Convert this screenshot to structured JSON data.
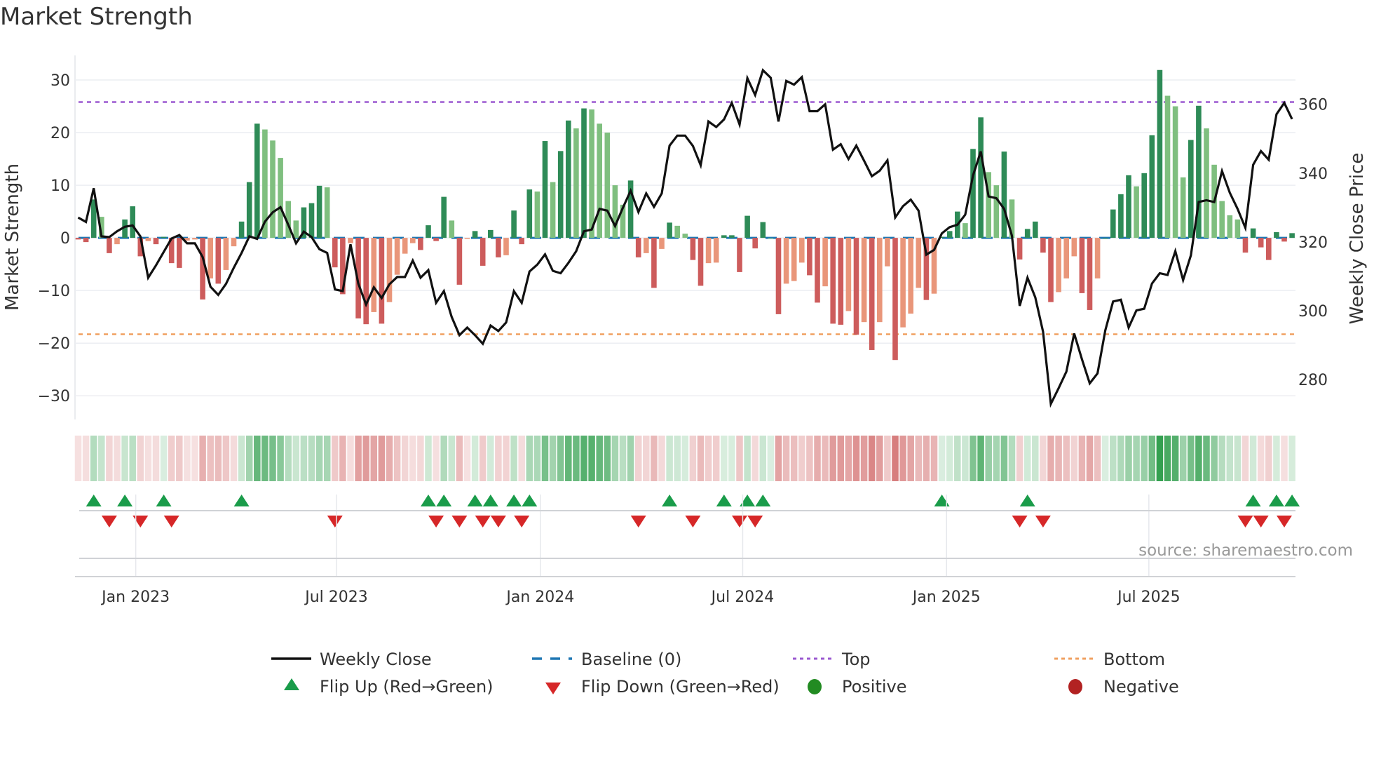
{
  "chart_data": {
    "type": "bar",
    "title": "Market Strength",
    "ylabel": "Market Strength",
    "y2label": "Weekly Close Price",
    "ylim": [
      -34.5,
      34.4
    ],
    "y2lim": [
      268.4,
      373.8
    ],
    "yticks": [
      30,
      20,
      10,
      0,
      -10,
      -20,
      -30
    ],
    "ytick_labels": [
      "30",
      "20",
      "10",
      "0",
      "−10",
      "−20",
      "−30"
    ],
    "y2ticks": [
      280,
      300,
      320,
      340,
      360
    ],
    "y2tick_labels": [
      "280",
      "300",
      "320",
      "340",
      "360"
    ],
    "xtick_labels": [
      "Jan 2023",
      "Jul 2023",
      "Jan 2024",
      "Jul 2024",
      "Jan 2025",
      "Jul 2025"
    ],
    "xtick_weeks": [
      7.4,
      33.2,
      59.4,
      85.4,
      111.6,
      137.6
    ],
    "top_level": 25.8,
    "bottom_level": -18.3,
    "grid": true,
    "legend_position": "bottom",
    "source": "source: sharemaestro.com",
    "strength": [
      -0.3,
      -0.8,
      7.3,
      4,
      -2.9,
      -1.2,
      3.5,
      6,
      -3.5,
      -0.6,
      -1.2,
      0.2,
      -4.8,
      -5.7,
      -0.5,
      -0.3,
      -11.7,
      -7.7,
      -8.7,
      -6.1,
      -1.6,
      3.1,
      10.6,
      21.7,
      20.6,
      18.5,
      15.2,
      7,
      3.3,
      5.8,
      6.6,
      9.9,
      9.6,
      -5.6,
      -10.7,
      -1,
      -15.3,
      -16.4,
      -14.1,
      -16.3,
      -12.2,
      -7,
      -3,
      -1,
      -2.3,
      2.4,
      -0.6,
      7.8,
      3.3,
      -8.9,
      -0.2,
      1.3,
      -5.3,
      1.5,
      -3.7,
      -3.3,
      5.2,
      -1.2,
      9.2,
      8.8,
      18.4,
      10.6,
      16.5,
      22.3,
      20.8,
      24.6,
      24.4,
      21.7,
      20,
      10,
      6.3,
      10.9,
      -3.7,
      -2.9,
      -9.5,
      -2.1,
      2.9,
      2.3,
      0.8,
      -4.2,
      -9.1,
      -4.8,
      -4.7,
      0.5,
      0.5,
      -6.5,
      4.2,
      -2,
      3,
      0,
      -14.5,
      -8.7,
      -8.2,
      -4.7,
      -7.1,
      -12.3,
      -9.2,
      -16.3,
      -16.5,
      -13.9,
      -18.4,
      -16,
      -21.3,
      -16,
      -5.4,
      -23.2,
      -17,
      -14.4,
      -9.5,
      -11.8,
      -10.6,
      0.2,
      1.3,
      5,
      2.8,
      16.9,
      22.9,
      12.5,
      10,
      16.4,
      7.3,
      -4.1,
      1.7,
      3.1,
      -2.8,
      -12.2,
      -10.3,
      -7.7,
      -3.5,
      -10.5,
      -13.7,
      -7.7,
      0,
      5.4,
      8.3,
      11.9,
      9.8,
      12.3,
      19.5,
      31.9,
      27,
      25,
      11.5,
      18.6,
      25.1,
      20.8,
      13.9,
      7,
      4.3,
      3.5,
      -2.8,
      1.8,
      -1.8,
      -4.2,
      1.1,
      -0.7,
      0.9
    ],
    "weekly_close": [
      327.1,
      325.8,
      335.6,
      321.6,
      321.4,
      323.1,
      324.4,
      324.8,
      321.6,
      309.6,
      313.2,
      317.1,
      321,
      322,
      319.6,
      319.6,
      315.6,
      307,
      304.6,
      307.8,
      312.5,
      316.8,
      321.6,
      320.9,
      325.9,
      328.6,
      330.1,
      325,
      319.6,
      323,
      321.4,
      317.9,
      316.8,
      306.2,
      305.7,
      319.3,
      307.9,
      301.8,
      306.8,
      303.7,
      307.7,
      309.8,
      309.8,
      314.6,
      309.6,
      311.8,
      302.3,
      305.7,
      298.2,
      292.9,
      295.1,
      292.9,
      290.4,
      295.7,
      294.1,
      296.6,
      305.7,
      302.3,
      311.4,
      313.4,
      316.4,
      311.6,
      310.9,
      313.9,
      317.3,
      323.1,
      323.6,
      329.6,
      329.1,
      324.6,
      329.9,
      334.9,
      328.7,
      334.1,
      330.2,
      334.1,
      348,
      350.9,
      350.9,
      347.9,
      342.3,
      355,
      353.4,
      355.6,
      360.4,
      354.1,
      367.6,
      362.7,
      369.9,
      367.7,
      355,
      366.8,
      365.7,
      367.9,
      358,
      358,
      360,
      346.8,
      348.4,
      344.1,
      348,
      343.6,
      339.1,
      340.7,
      343.7,
      327.1,
      330.4,
      332.3,
      329.1,
      316.3,
      317.7,
      322.5,
      324.3,
      325,
      327.9,
      339.3,
      346.3,
      333.2,
      332.7,
      329.6,
      321.8,
      301.4,
      309.6,
      303.9,
      293.9,
      272.9,
      277.5,
      282.3,
      293.4,
      285.9,
      278.9,
      281.8,
      294.3,
      302.7,
      303.2,
      295.1,
      300.1,
      300.6,
      307.9,
      310.9,
      310.4,
      317.3,
      308.9,
      316.1,
      331.6,
      332.1,
      331.6,
      340.6,
      334.3,
      329.6,
      324.1,
      342.4,
      346.4,
      343.9,
      357.1,
      360.4,
      355.7
    ],
    "legend": {
      "weekly_close": "Weekly Close",
      "baseline": "Baseline (0)",
      "top": "Top",
      "bottom": "Bottom",
      "flip_up": "Flip Up (Red→Green)",
      "flip_down": "Flip Down (Green→Red)",
      "positive": "Positive",
      "negative": "Negative"
    },
    "colors": {
      "up_strong": "#2e8b57",
      "up_weak": "#7fbf7f",
      "down_strong": "#cd5c5c",
      "down_weak": "#e9967a",
      "line": "#111111",
      "baseline": "#1f77b4",
      "top": "#9b59d0",
      "bottom": "#f0a060",
      "flip_up": "#1a9c4a",
      "flip_down": "#d62728",
      "positive": "#228b22",
      "negative": "#b22222"
    }
  }
}
